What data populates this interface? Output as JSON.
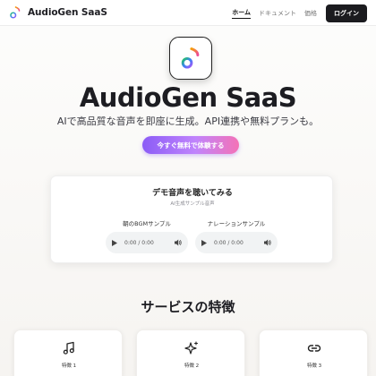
{
  "brand": {
    "name": "AudioGen SaaS"
  },
  "nav": {
    "items": [
      {
        "label": "ホーム",
        "active": true
      },
      {
        "label": "ドキュメント",
        "active": false
      },
      {
        "label": "価格",
        "active": false
      }
    ],
    "login_label": "ログイン"
  },
  "hero": {
    "title": "AudioGen SaaS",
    "subtitle": "AIで高品質な音声を即座に生成。API連携や無料プランも。",
    "cta_label": "今すぐ無料で体験する"
  },
  "demo": {
    "title": "デモ音声を聴いてみる",
    "subtitle": "AI生成サンプル音声",
    "samples": [
      {
        "label": "朝のBGMサンプル",
        "time": "0:00 / 0:00"
      },
      {
        "label": "ナレーションサンプル",
        "time": "0:00 / 0:00"
      }
    ]
  },
  "services": {
    "title": "サービスの特徴",
    "features": [
      {
        "label": "特徴 1",
        "icon": "music-note-icon"
      },
      {
        "label": "特徴 2",
        "icon": "sparkles-icon"
      },
      {
        "label": "特徴 3",
        "icon": "link-icon"
      }
    ]
  },
  "colors": {
    "accent_start": "#8b5cf6",
    "accent_end": "#f472b6",
    "login_bg": "#1b1b1f"
  }
}
